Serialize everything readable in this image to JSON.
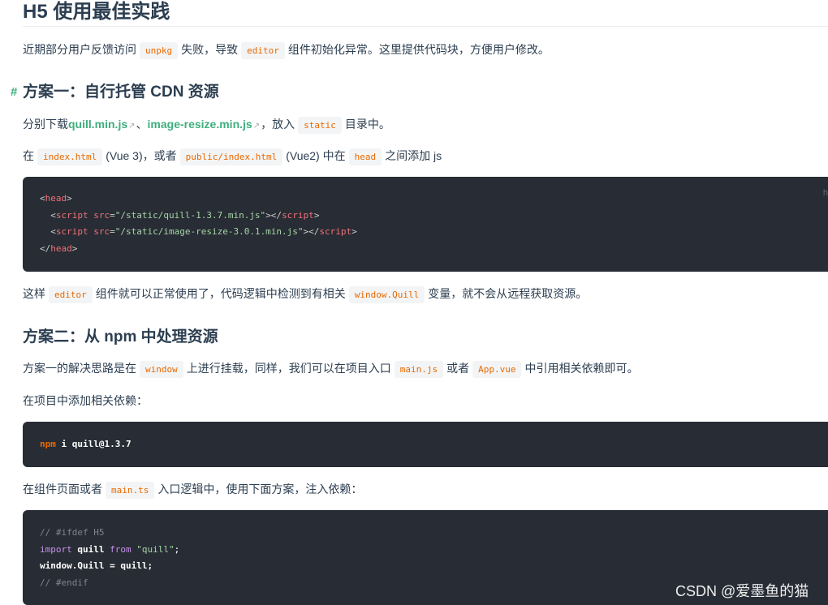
{
  "title": "H5 使用最佳实践",
  "intro": {
    "t1": "近期部分用户反馈访问",
    "c1": "unpkg",
    "t2": "失败，导致",
    "c2": "editor",
    "t3": "组件初始化异常。这里提供代码块，方便用户修改。"
  },
  "section1": {
    "anchor": "#",
    "heading": "方案一：自行托管 CDN 资源",
    "p1": {
      "t1": "分别下载",
      "link1": "quill.min.js",
      "sep": "、",
      "link2": "image-resize.min.js",
      "t2": "，放入",
      "c1": "static",
      "t3": "目录中。",
      "ext_icon": "↗"
    },
    "p2": {
      "t1": "在",
      "c1": "index.html",
      "t2": "(Vue 3)，或者",
      "c2": "public/index.html",
      "t3": "(Vue2) 中在",
      "c3": "head",
      "t4": "之间添加 js"
    },
    "code": {
      "lang": "h",
      "l1_open": "<",
      "l1_tag": "head",
      "l1_close": ">",
      "l2_open": "<",
      "l2_tag": "script",
      "l2_attr": "src",
      "l2_eq": "=",
      "l2_str": "\"/static/quill-1.3.7.min.js\"",
      "l2_mid": "></",
      "l2_tag2": "script",
      "l2_end": ">",
      "l3_open": "<",
      "l3_tag": "script",
      "l3_attr": "src",
      "l3_eq": "=",
      "l3_str": "\"/static/image-resize-3.0.1.min.js\"",
      "l3_mid": "></",
      "l3_tag2": "script",
      "l3_end": ">",
      "l4_open": "</",
      "l4_tag": "head",
      "l4_close": ">"
    },
    "p3": {
      "t1": "这样",
      "c1": "editor",
      "t2": "组件就可以正常使用了，代码逻辑中检测到有相关",
      "c2": "window.Quill",
      "t3": "变量，就不会从远程获取资源。"
    }
  },
  "section2": {
    "heading": "方案二：从 npm 中处理资源",
    "p1": {
      "t1": "方案一的解决思路是在",
      "c1": "window",
      "t2": "上进行挂载，同样，我们可以在项目入口",
      "c2": "main.js",
      "t3": "或者",
      "c3": "App.vue",
      "t4": "中引用相关依赖即可。"
    },
    "p2": "在项目中添加相关依赖：",
    "code1": {
      "kw": "npm",
      "rest": " i quill@1.3.7"
    },
    "p3": {
      "t1": "在组件页面或者",
      "c1": "main.ts",
      "t2": "入口逻辑中，使用下面方案，注入依赖："
    },
    "code2": {
      "l1": "// #ifdef H5",
      "l2_kw": "import",
      "l2_a": " quill ",
      "l2_from": "from",
      "l2_str": "\"quill\"",
      "l2_end": ";",
      "l3": "window.Quill = quill;",
      "l4": "// #endif"
    }
  },
  "watermark": "CSDN @爱墨鱼的猫"
}
